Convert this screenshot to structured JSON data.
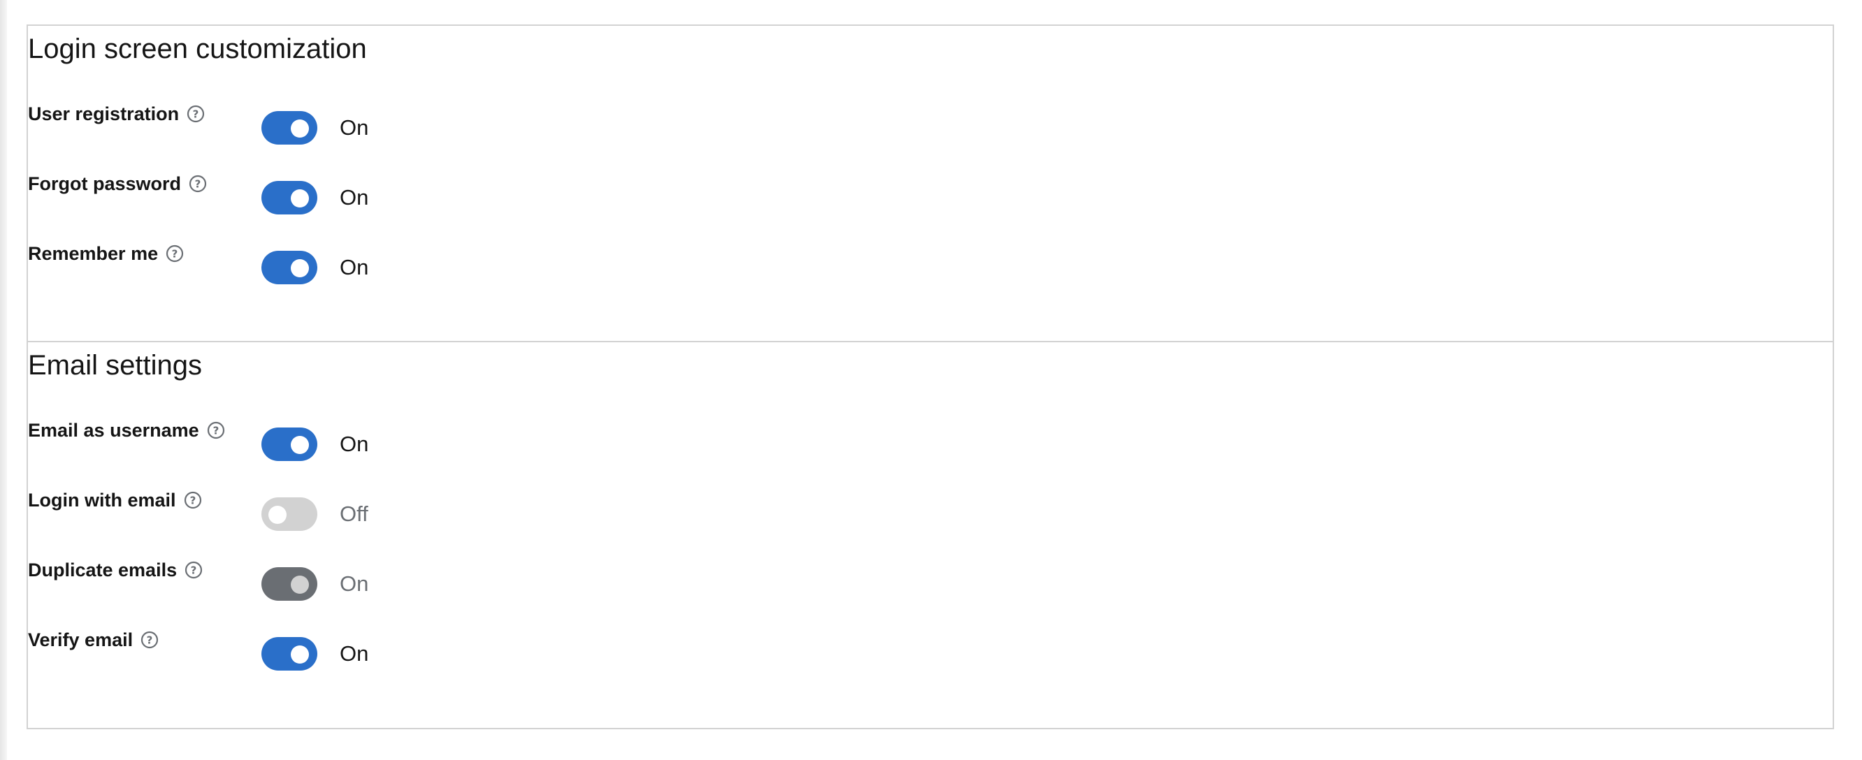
{
  "sections": [
    {
      "title": "Login screen customization",
      "settings": [
        {
          "label": "User registration",
          "state": "On",
          "enabled": true,
          "disabled": false
        },
        {
          "label": "Forgot password",
          "state": "On",
          "enabled": true,
          "disabled": false
        },
        {
          "label": "Remember me",
          "state": "On",
          "enabled": true,
          "disabled": false
        }
      ]
    },
    {
      "title": "Email settings",
      "settings": [
        {
          "label": "Email as username",
          "state": "On",
          "enabled": true,
          "disabled": false
        },
        {
          "label": "Login with email",
          "state": "Off",
          "enabled": false,
          "disabled": true
        },
        {
          "label": "Duplicate emails",
          "state": "On",
          "enabled": true,
          "disabled": true
        },
        {
          "label": "Verify email",
          "state": "On",
          "enabled": true,
          "disabled": false
        }
      ]
    }
  ],
  "icons": {
    "help": "help-circle-icon"
  },
  "colors": {
    "switch_on": "#2a6fc9",
    "switch_off_disabled": "#d2d2d2",
    "switch_on_disabled": "#6a6e73",
    "text": "#151515",
    "muted_text": "#6a6e73",
    "border": "#d2d2d2"
  }
}
